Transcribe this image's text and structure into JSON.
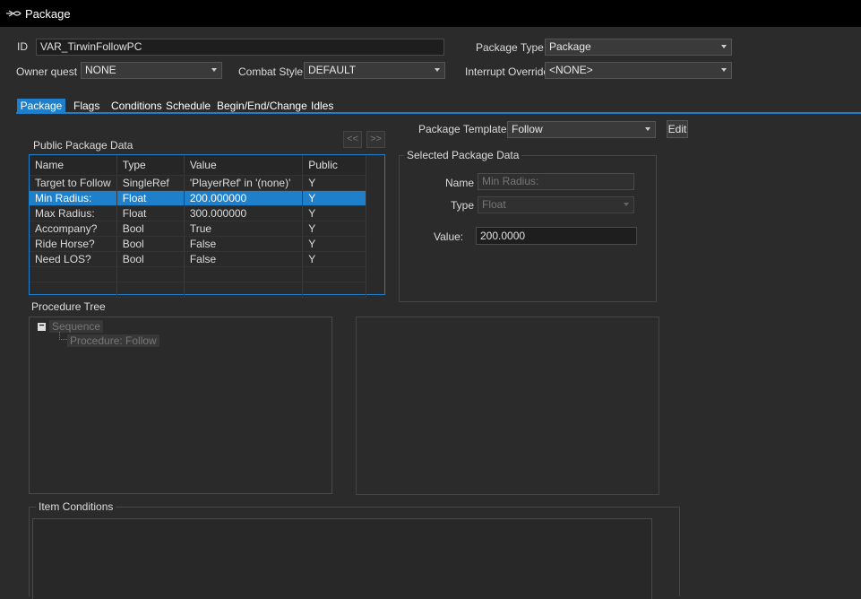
{
  "window": {
    "title": "Package"
  },
  "header": {
    "id_label": "ID",
    "id_value": "VAR_TirwinFollowPC",
    "package_type_label": "Package Type",
    "package_type_value": "Package",
    "owner_quest_label": "Owner quest",
    "owner_quest_value": "NONE",
    "combat_style_label": "Combat Style",
    "combat_style_value": "DEFAULT",
    "interrupt_override_label": "Interrupt Override",
    "interrupt_override_value": "<NONE>"
  },
  "tabs": [
    {
      "label": "Package"
    },
    {
      "label": "Flags"
    },
    {
      "label": "Conditions"
    },
    {
      "label": "Schedule"
    },
    {
      "label": "Begin/End/Change"
    },
    {
      "label": "Idles"
    }
  ],
  "package_tab": {
    "template_label": "Package Template",
    "template_value": "Follow",
    "edit_label": "Edit",
    "public_data_label": "Public Package Data",
    "prev_label": "<<",
    "next_label": ">>",
    "columns": [
      "Name",
      "Type",
      "Value",
      "Public"
    ],
    "rows": [
      {
        "name": "Target to Follow",
        "type": "SingleRef",
        "value": "'PlayerRef' in '(none)'",
        "public": "Y"
      },
      {
        "name": "Min Radius:",
        "type": "Float",
        "value": "200.000000",
        "public": "Y"
      },
      {
        "name": "Max Radius:",
        "type": "Float",
        "value": "300.000000",
        "public": "Y"
      },
      {
        "name": "Accompany?",
        "type": "Bool",
        "value": "True",
        "public": "Y"
      },
      {
        "name": "Ride Horse?",
        "type": "Bool",
        "value": "False",
        "public": "Y"
      },
      {
        "name": "Need LOS?",
        "type": "Bool",
        "value": "False",
        "public": "Y"
      }
    ],
    "selected_data": {
      "title": "Selected Package Data",
      "name_label": "Name",
      "name_value": "Min Radius:",
      "type_label": "Type",
      "type_value": "Float",
      "value_label": "Value:",
      "value_value": "200.0000"
    },
    "procedure_tree_label": "Procedure Tree",
    "tree": {
      "root": "Sequence",
      "child": "Procedure: Follow",
      "expander": "−"
    },
    "item_conditions_label": "Item Conditions"
  },
  "colors": {
    "accent": "#1e7fcb",
    "background": "#2b2b2b",
    "titlebar": "#000000"
  }
}
